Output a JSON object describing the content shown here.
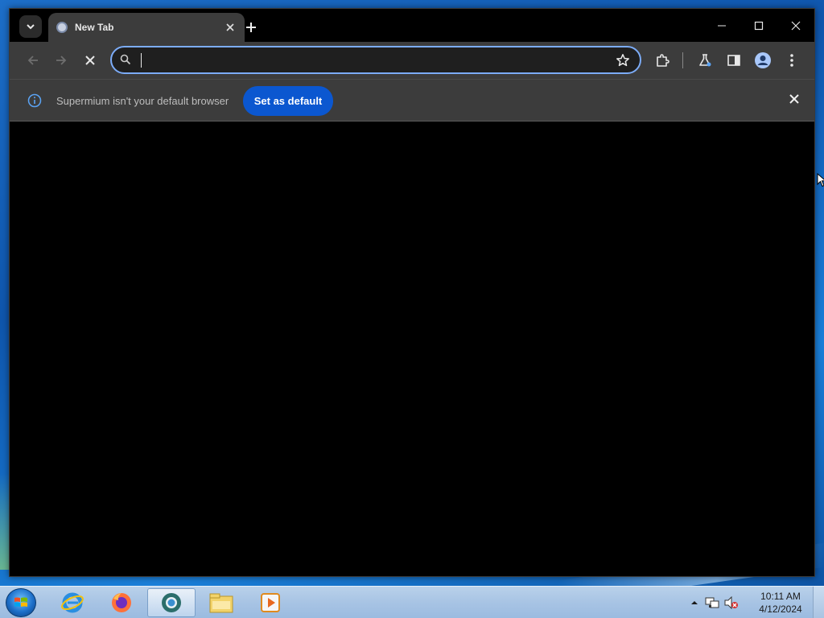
{
  "window": {
    "tab": {
      "title": "New Tab",
      "favicon": "supermium-favicon-icon"
    },
    "controls": [
      "minimize-icon",
      "maximize-icon",
      "close-icon"
    ]
  },
  "toolbar": {
    "omnibox": {
      "value": "",
      "placeholder": ""
    },
    "icons": [
      "back-arrow-icon",
      "forward-arrow-icon",
      "stop-loading-icon",
      "search-icon",
      "bookmark-star-icon",
      "extensions-icon",
      "labs-flask-icon",
      "side-panel-icon",
      "profile-avatar-icon",
      "menu-kebab-icon"
    ]
  },
  "infobar": {
    "message": "Supermium isn't your default browser",
    "button_label": "Set as default"
  },
  "taskbar": {
    "apps": [
      "internet-explorer-icon",
      "firefox-icon",
      "supermium-icon",
      "file-explorer-icon",
      "media-player-icon"
    ],
    "clock_time": "10:11 AM",
    "clock_date": "4/12/2024"
  },
  "colors": {
    "accent": "#0b57d0",
    "omnibox_focus": "#7cacf8",
    "toolbar_bg": "#3c3c3c",
    "tabstrip_bg": "#000000"
  }
}
